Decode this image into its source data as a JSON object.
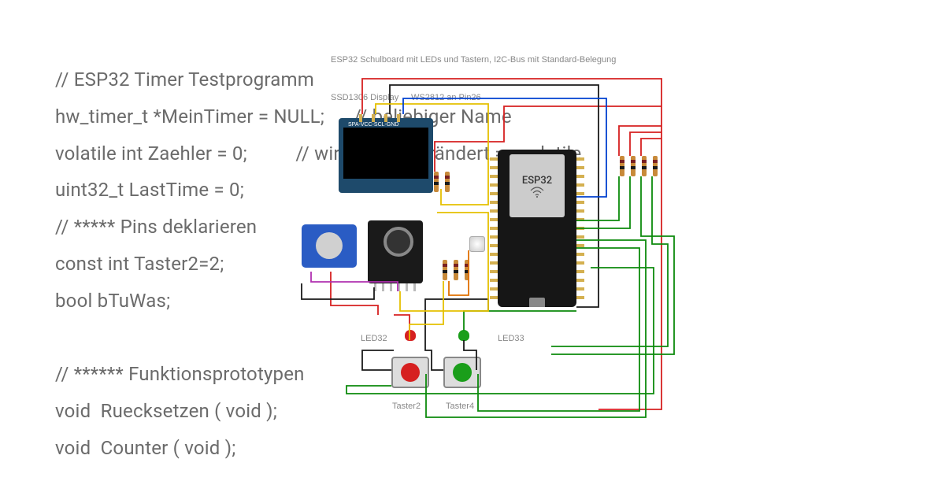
{
  "code": {
    "line1": "// ESP32 Timer Testprogramm",
    "line2": "hw_timer_t *MeinTimer = NULL;      // beliebiger Name",
    "line3": "volatile int Zaehler = 0;          // wird in ISR verändert => volatile",
    "line4": "uint32_t LastTime = 0;",
    "line5": "// ***** Pins deklarieren",
    "line6": "const int Taster2=2;",
    "line7": "bool bTuWas;",
    "line8": "",
    "line9": "// ****** Funktionsprototypen",
    "line10": "void  Ruecksetzen ( void );",
    "line11": "void  Counter ( void );"
  },
  "labels": {
    "title": "ESP32 Schulboard mit LEDs und Tastern, I2C-Bus mit Standard-Belegung",
    "display": "SSD1306 Display",
    "ws2812": "WS2812 an Pin26",
    "led32": "LED32",
    "led33": "LED33",
    "taster2": "Taster2",
    "taster4": "Taster4",
    "oled_pins": "SPA-VCC-SCL-GND"
  },
  "components": {
    "mcu": "ESP32",
    "display_type": "SSD1306",
    "ledstrip": "WS2812",
    "ledstrip_pin": 26,
    "led_red_pin": 32,
    "led_green_pin": 33,
    "button_red_pin": 2,
    "button_green_pin": 4,
    "potentiometer": true,
    "rotary_encoder": true,
    "resistor_count": 8
  },
  "wire_colors": {
    "power_5v": "#d62020",
    "ground": "#1a1a1a",
    "i2c_sda": "#e5c000",
    "i2c_scl": "#0040d0",
    "signal_green": "#0c8a0c",
    "signal_magenta": "#b030b0",
    "signal_orange": "#e07000"
  }
}
